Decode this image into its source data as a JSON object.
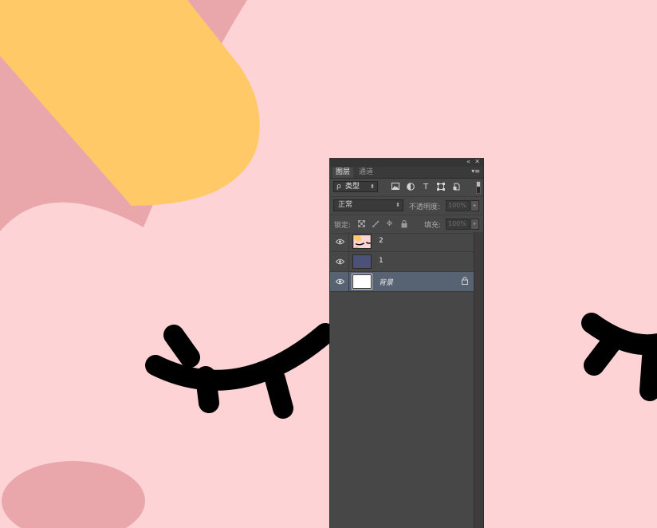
{
  "panel": {
    "collapse_icon": "«",
    "close_icon": "✕",
    "menu_icon": "▾≡",
    "tabs": [
      {
        "label": "图层",
        "active": true
      },
      {
        "label": "通道",
        "active": false
      }
    ]
  },
  "filter": {
    "search_icon": "ρ",
    "kind_label": "类型",
    "icons": [
      "image-filter-icon",
      "adjustment-filter-icon",
      "type-filter-icon",
      "shape-filter-icon",
      "smart-object-filter-icon"
    ]
  },
  "blend": {
    "mode": "正常",
    "opacity_label": "不透明度:",
    "opacity_value": "100%"
  },
  "lock": {
    "label": "锁定:",
    "fill_label": "填充:",
    "fill_value": "100%"
  },
  "layers": [
    {
      "name": "2",
      "thumb": "image",
      "selected": false,
      "locked": false,
      "italic": false
    },
    {
      "name": "1",
      "thumb": "#4b5177",
      "selected": false,
      "locked": false,
      "italic": false
    },
    {
      "name": "背景",
      "thumb": "#ffffff",
      "selected": true,
      "locked": true,
      "italic": true
    }
  ],
  "colors": {
    "canvas_pink": "#fed3d5",
    "canvas_rose": "#eaa7ab",
    "canvas_yellow": "#fec966",
    "lashes": "#000000",
    "panel_bg": "#474747",
    "selected_layer": "#576273"
  }
}
